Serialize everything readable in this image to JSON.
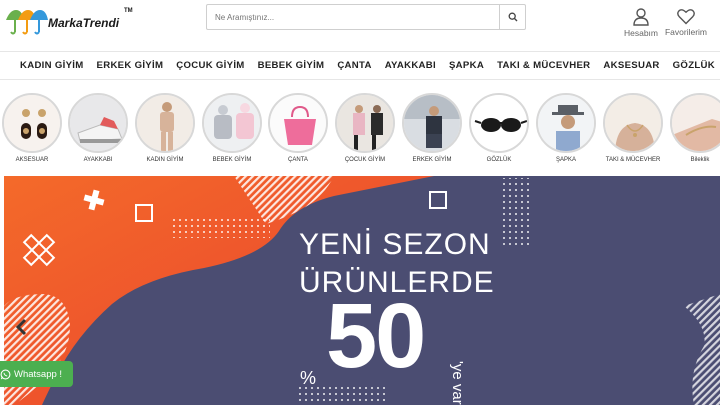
{
  "header": {
    "logo_text": "MarkaTrendi",
    "logo_tm": "TM",
    "search_placeholder": "Ne Aramıştınız...",
    "account_label": "Hesabım",
    "favorites_label": "Favorilerim"
  },
  "nav": {
    "items": [
      "KADIN GİYİM",
      "ERKEK GİYİM",
      "ÇOCUK GİYİM",
      "BEBEK GİYİM",
      "ÇANTA",
      "AYAKKABI",
      "ŞAPKA",
      "TAKI & MÜCEVHER",
      "AKSESUAR",
      "GÖZLÜK"
    ]
  },
  "categories": {
    "items": [
      {
        "label": "AKSESUAR"
      },
      {
        "label": "AYAKKABI"
      },
      {
        "label": "KADIN GİYİM"
      },
      {
        "label": "BEBEK GİYİM"
      },
      {
        "label": "ÇANTA"
      },
      {
        "label": "ÇOCUK GİYİM"
      },
      {
        "label": "ERKEK GİYİM"
      },
      {
        "label": "GÖZLÜK"
      },
      {
        "label": "ŞAPKA"
      },
      {
        "label": "TAKI & MÜCEVHER"
      },
      {
        "label": "Bileklik"
      }
    ]
  },
  "banner": {
    "line1": "YENİ SEZON",
    "line2": "ÜRÜNLERDE",
    "percent": "%",
    "number": "50",
    "suffix": "'ye varan"
  },
  "whatsapp": {
    "label": "Whatsapp !"
  },
  "colors": {
    "banner_bg": "#4b4d72",
    "banner_orange": "#f0522a",
    "whatsapp": "#4caf50"
  }
}
